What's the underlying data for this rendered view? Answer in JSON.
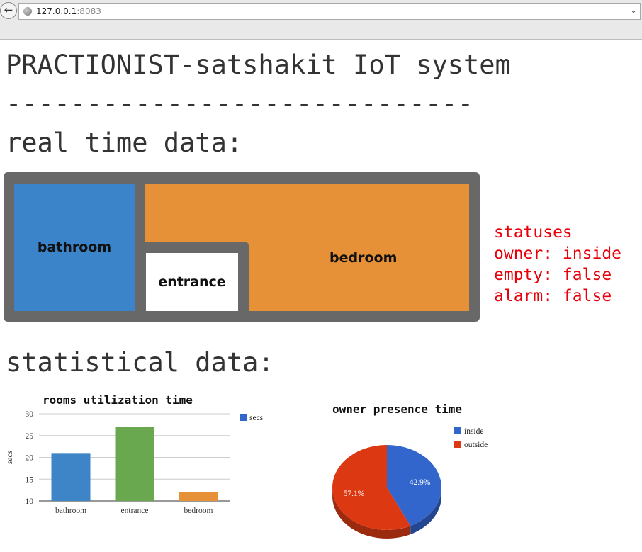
{
  "browser": {
    "url_host": "127.0.0.1",
    "url_port": ":8083",
    "back_icon": "back-arrow-icon",
    "dropdown_icon": "chevron-down-icon"
  },
  "page": {
    "title": "PRACTIONIST-satshakit IoT system",
    "divider": "-----------------------------",
    "realtime_heading": "real time data:",
    "statistical_heading": "statistical data:"
  },
  "floorplan": {
    "rooms": {
      "bathroom": "bathroom",
      "bedroom": "bedroom",
      "entrance": "entrance"
    },
    "colors": {
      "bathroom": "#3b84c9",
      "bedroom": "#e69138",
      "entrance": "#ffffff",
      "walls": "#686868"
    }
  },
  "statuses": {
    "heading": "statuses",
    "owner": "owner: inside",
    "empty": "empty: false",
    "alarm": "alarm: false",
    "color": "#e8000a"
  },
  "chart_data": [
    {
      "type": "bar",
      "title": "rooms utilization time",
      "categories": [
        "bathroom",
        "entrance",
        "bedroom"
      ],
      "series": [
        {
          "name": "secs",
          "values": [
            21,
            27,
            12
          ]
        }
      ],
      "bar_colors": [
        "#3d85c6",
        "#6aa84f",
        "#e69138"
      ],
      "legend_color": "#3366cc",
      "ylabel": "secs",
      "ylim": [
        10,
        30
      ],
      "yticks": [
        10,
        15,
        20,
        25,
        30
      ],
      "grid": true,
      "legend": "right"
    },
    {
      "type": "pie",
      "title": "owner presence time",
      "labels": [
        "inside",
        "outside"
      ],
      "values": [
        42.9,
        57.1
      ],
      "value_labels": [
        "42.9%",
        "57.1%"
      ],
      "colors": [
        "#3366cc",
        "#dc3912"
      ],
      "legend": "top-right"
    }
  ]
}
